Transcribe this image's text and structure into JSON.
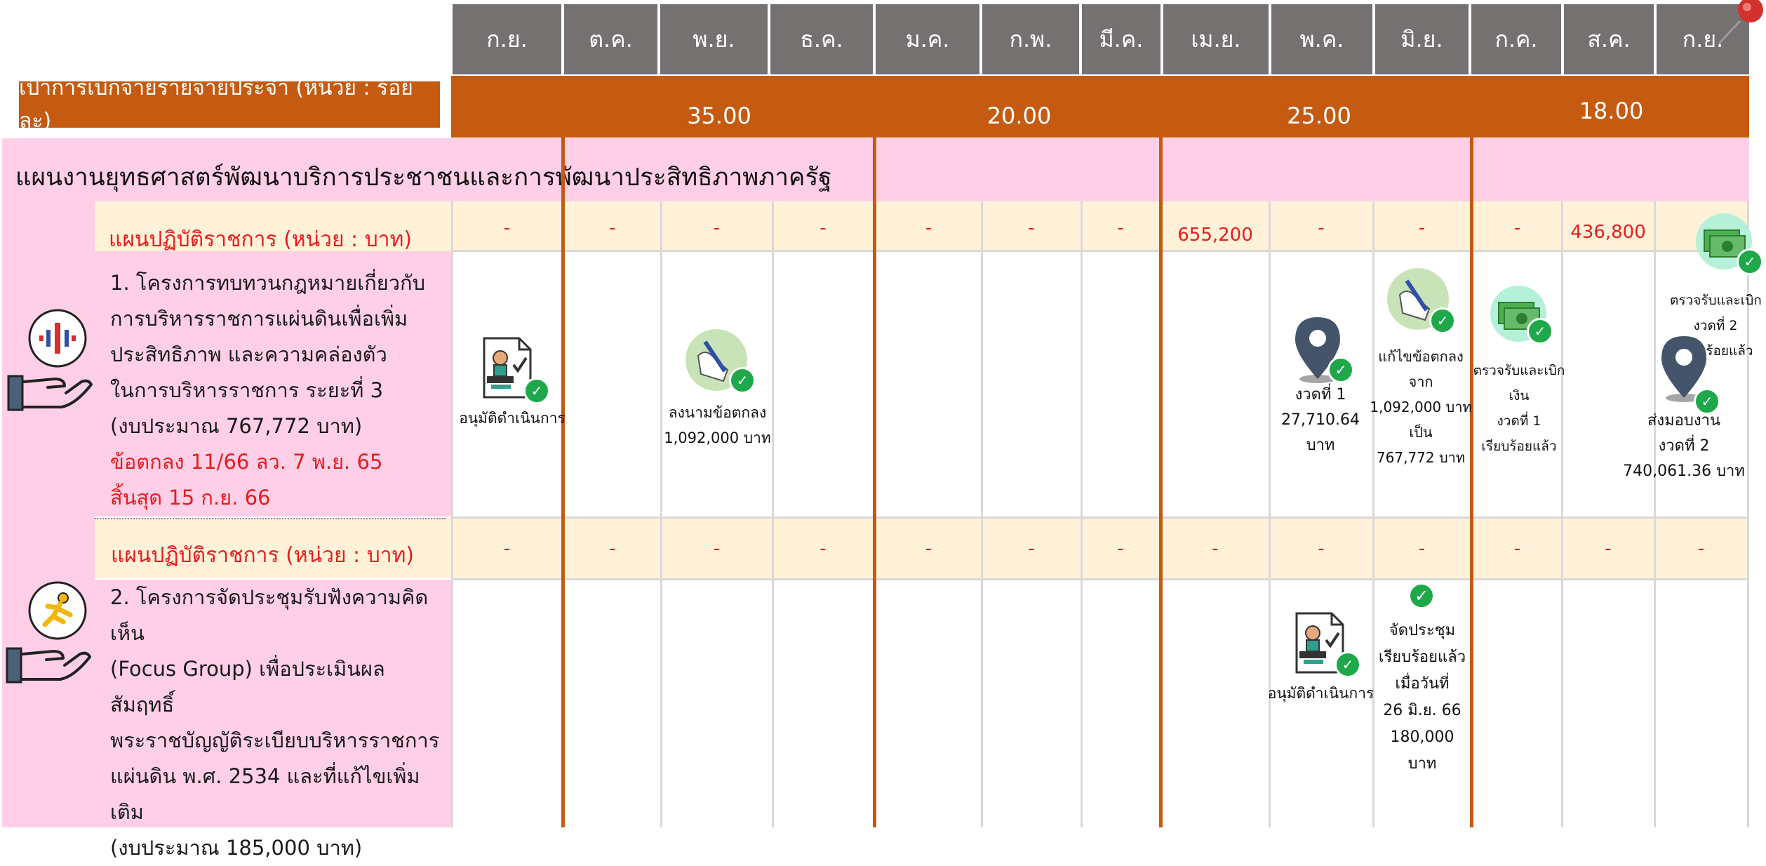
{
  "months": [
    "ก.ย.",
    "ต.ค.",
    "พ.ย.",
    "ธ.ค.",
    "ม.ค.",
    "ก.พ.",
    "มี.ค.",
    "เม.ย.",
    "พ.ค.",
    "มิ.ย.",
    "ก.ค.",
    "ส.ค.",
    "ก.ย."
  ],
  "target": {
    "label": "เป้าการเบิกจ่ายรายจ่ายประจำ (หน่วย : ร้อยละ)",
    "values": [
      "35.00",
      "20.00",
      "25.00",
      "18.00"
    ]
  },
  "strategy_title": "แผนงานยุทธศาสตร์พัฒนาบริการประชาชนและการพัฒนาประสิทธิภาพภาครัฐ",
  "colors": {
    "month_header": "#767171",
    "target_band": "#c55a11",
    "pink": "#ffcfe8",
    "cream": "#fff2d9",
    "red_text": "#e81c1c",
    "check": "#1fa84a"
  },
  "projects": [
    {
      "plan_label": "แผนปฏิบัติราชการ (หน่วย : บาท)",
      "plan_values": [
        "-",
        "-",
        "-",
        "-",
        "-",
        "-",
        "-",
        "655,200",
        "-",
        "-",
        "-",
        "436,800",
        ""
      ],
      "lines": [
        "1. โครงการทบทวนกฎหมายเกี่ยวกับ",
        "การบริหารราชการแผ่นดินเพื่อเพิ่ม",
        "ประสิทธิภาพ และความคล่องตัว",
        "ในการบริหารราชการ ระยะที่ 3",
        "(งบประมาณ 767,772 บาท)"
      ],
      "red_lines": [
        "ข้อตกลง 11/66 ลว. 7 พ.ย. 65",
        "สิ้นสุด 15 ก.ย. 66"
      ],
      "icon": "hand-logo-icon",
      "milestones": [
        {
          "icon": "approval-document-icon",
          "caption": [
            "อนุมัติดำเนินการ"
          ]
        },
        {
          "icon": "signed-contract-icon",
          "caption": [
            "ลงนามข้อตกลง",
            "1,092,000 บาท"
          ]
        },
        {
          "icon": "location-pin-icon",
          "caption": [
            "งวดที่ 1",
            "27,710.64 บาท"
          ]
        },
        {
          "icon": "signed-contract-icon",
          "caption": [
            "แก้ไขข้อตกลงจาก",
            "1,092,000 บาท",
            "เป็น",
            "767,772 บาท"
          ]
        },
        {
          "icon": "money-icon",
          "caption": [
            "ตรวจรับและเบิกเงิน",
            "งวดที่ 1",
            "เรียบร้อยแล้ว"
          ]
        },
        {
          "icon": "money-icon",
          "caption": [
            "ตรวจรับและเบิกเงิน",
            "งวดที่ 2",
            "เรียบร้อยแล้ว"
          ]
        },
        {
          "icon": "location-pin-icon",
          "caption": [
            "ส่งมอบงาน",
            "งวดที่ 2",
            "740,061.36 บาท"
          ]
        }
      ]
    },
    {
      "plan_label": "แผนปฏิบัติราชการ (หน่วย : บาท)",
      "plan_values": [
        "-",
        "-",
        "-",
        "-",
        "-",
        "-",
        "-",
        "-",
        "-",
        "-",
        "-",
        "-",
        "-"
      ],
      "lines": [
        "2. โครงการจัดประชุมรับฟังความคิดเห็น",
        "(Focus Group) เพื่อประเมินผลสัมฤทธิ์",
        "พระราชบัญญัติระเบียบบริหารราชการ",
        "แผ่นดิน พ.ศ. 2534 และที่แก้ไขเพิ่มเติม",
        "(งบประมาณ 185,000 บาท)"
      ],
      "red_lines": [],
      "icon": "running-person-hand-icon",
      "milestones": [
        {
          "icon": "approval-document-icon",
          "caption": [
            "อนุมัติดำเนินการ"
          ]
        },
        {
          "icon": "check-icon",
          "caption": [
            "จัดประชุม",
            "เรียบร้อยแล้ว",
            "เมื่อวันที่",
            "26 มิ.ย. 66",
            "180,000 บาท"
          ]
        }
      ]
    }
  ]
}
